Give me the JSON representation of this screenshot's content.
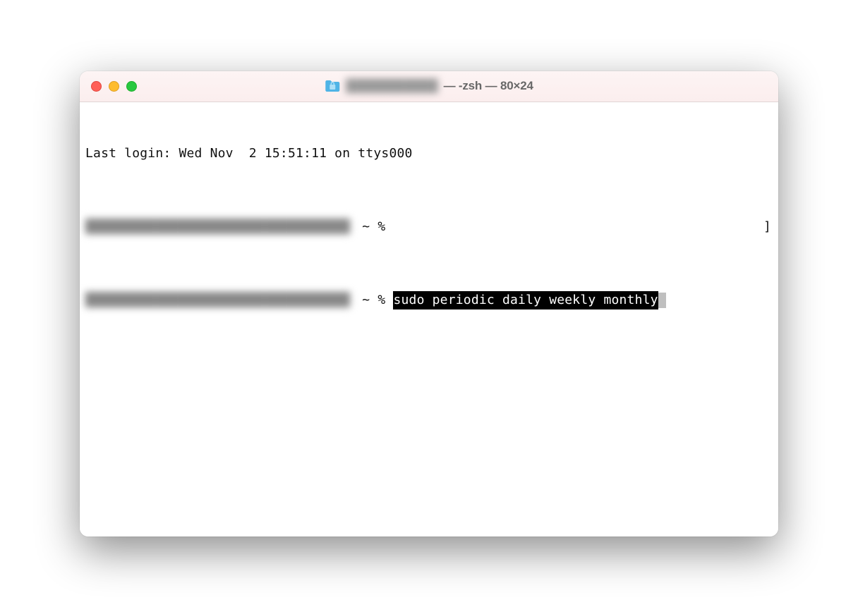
{
  "window": {
    "title_suffix": " — -zsh — 80×24",
    "title_obscured": "███████████"
  },
  "terminal": {
    "last_login": "Last login: Wed Nov  2 15:51:11 on ttys000",
    "host_obscured_1": "██████████████████████████████████",
    "host_obscured_2": "██████████████████████████████████",
    "prompt_1": " ~ % ",
    "prompt_2": " ~ % ",
    "command_highlighted": "sudo periodic daily weekly monthly",
    "right_bracket": "]"
  },
  "colors": {
    "tl_close": "#ff5f57",
    "tl_min": "#febc2e",
    "tl_max": "#28c840"
  }
}
